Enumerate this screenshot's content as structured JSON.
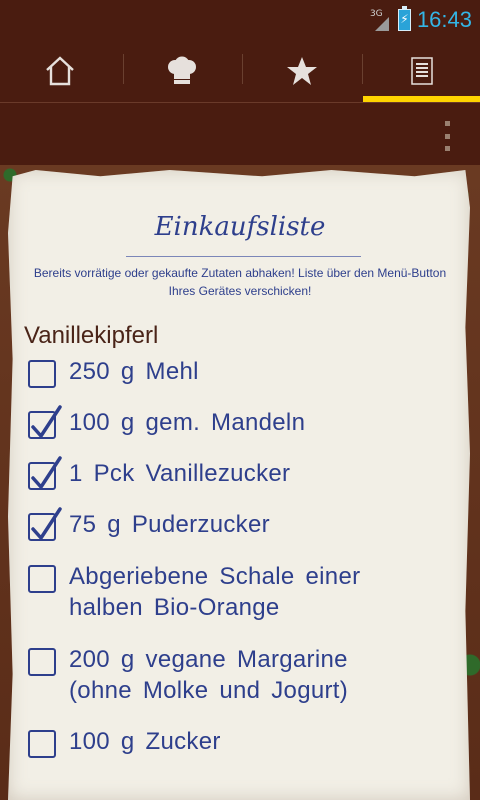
{
  "status": {
    "network": "3G",
    "time": "16:43"
  },
  "tabs": [
    {
      "name": "home",
      "icon": "home-icon"
    },
    {
      "name": "recipes",
      "icon": "chef-hat-icon"
    },
    {
      "name": "favorites",
      "icon": "star-icon"
    },
    {
      "name": "shopping-list",
      "icon": "list-icon",
      "selected": true
    }
  ],
  "page": {
    "title": "Einkaufsliste",
    "subtitle": "Bereits vorrätige oder gekaufte Zutaten abhaken! Liste über den Menü-Button Ihres Gerätes verschicken!",
    "recipe": "Vanillekipferl"
  },
  "items": [
    {
      "text": "250  g  Mehl",
      "checked": false
    },
    {
      "text": "100  g  gem. Mandeln",
      "checked": true
    },
    {
      "text": "1  Pck  Vanillezucker",
      "checked": true
    },
    {
      "text": "75  g  Puderzucker",
      "checked": true
    },
    {
      "text": "Abgeriebene Schale einer halben Bio-Orange",
      "checked": false
    },
    {
      "text": "200  g  vegane Margarine (ohne Molke und Jogurt)",
      "checked": false
    },
    {
      "text": "100  g  Zucker",
      "checked": false
    }
  ],
  "colors": {
    "bar": "#4a1c10",
    "accent": "#ffd400",
    "ink": "#2e3f8c",
    "paper": "#f2efe6",
    "clock": "#33b5e5"
  }
}
